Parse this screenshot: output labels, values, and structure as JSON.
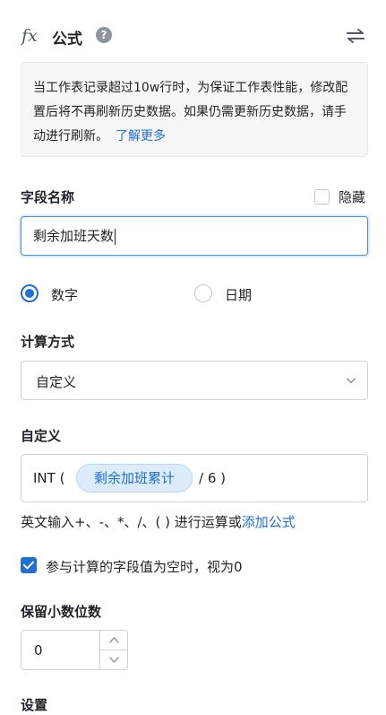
{
  "header": {
    "fx_glyph": "fx",
    "title": "公式",
    "help_glyph": "?"
  },
  "notice": {
    "text": "当工作表记录超过10w行时，为保证工作表性能，修改配置后将不再刷新历史数据。如果仍需更新历史数据，请手动进行刷新。",
    "link_label": "了解更多"
  },
  "field_name": {
    "label": "字段名称",
    "hide_label": "隐藏",
    "hide_checked": false,
    "value": "剩余加班天数"
  },
  "type_options": [
    {
      "label": "数字",
      "selected": true
    },
    {
      "label": "日期",
      "selected": false
    }
  ],
  "calc": {
    "label": "计算方式",
    "selected": "自定义"
  },
  "custom": {
    "label": "自定义",
    "prefix": "INT (",
    "chip": "剩余加班累计",
    "suffix": "/ 6 )"
  },
  "hint": {
    "text": "英文输入+、-、*、/、( ) 进行运算或",
    "link_label": "添加公式"
  },
  "empty_as_zero": {
    "label": "参与计算的字段值为空时，视为0",
    "checked": true
  },
  "decimals": {
    "label": "保留小数位数",
    "value": "0"
  },
  "settings": {
    "label": "设置"
  },
  "colors": {
    "accent": "#1f6fd6",
    "chip_bg": "#dcecfb",
    "notice_bg": "#f5f6f7"
  }
}
